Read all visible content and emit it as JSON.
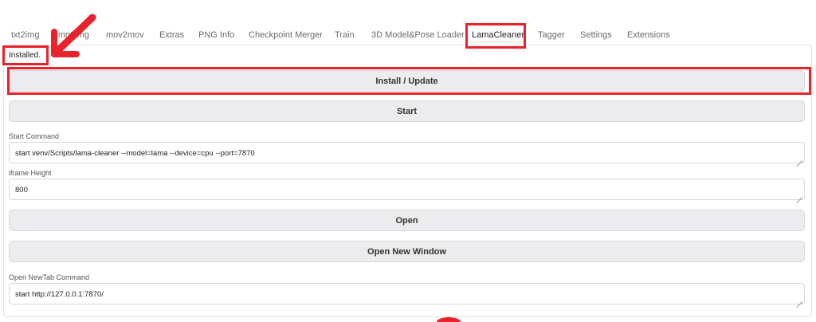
{
  "tabs": [
    {
      "label": "txt2img"
    },
    {
      "label": "img2img"
    },
    {
      "label": "mov2mov"
    },
    {
      "label": "Extras"
    },
    {
      "label": "PNG Info"
    },
    {
      "label": "Checkpoint Merger"
    },
    {
      "label": "Train"
    },
    {
      "label": "3D Model&Pose Loader"
    },
    {
      "label": "LamaCleaner"
    },
    {
      "label": "Tagger"
    },
    {
      "label": "Settings"
    },
    {
      "label": "Extensions"
    }
  ],
  "status": "Installed.",
  "buttons": {
    "install": "Install / Update",
    "start": "Start",
    "open": "Open",
    "open_new_window": "Open New Window"
  },
  "fields": {
    "start_command": {
      "label": "Start Command",
      "value": "start venv/Scripts/lama-cleaner --model=lama --device=cpu --port=7870"
    },
    "iframe_height": {
      "label": "iframe Height",
      "value": "800"
    },
    "open_newtab_command": {
      "label": "Open NewTab Command",
      "value": "start http://127.0.0.1:7870/"
    }
  },
  "colors": {
    "highlight": "#e8232b",
    "button_bg": "#ececee"
  }
}
